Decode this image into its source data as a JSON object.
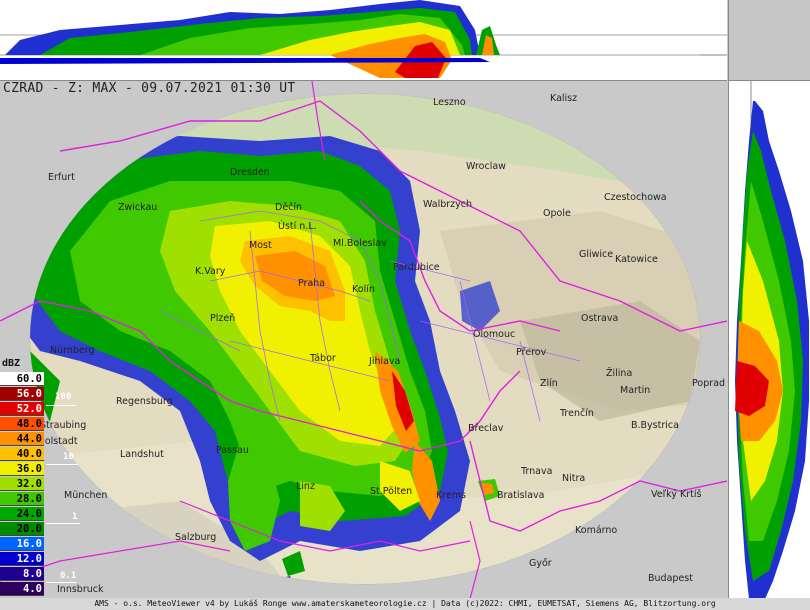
{
  "title": "CZRAD - Z: MAX - 09.07.2021 01:30 UT",
  "footer": "AMS - o.s. MeteoViewer v4 by Lukáš Ronge www.amaterskameteorologie.cz | Data (c)2022: CHMI, EUMETSAT, Siemens AG, Blitzortung.org",
  "legend": {
    "unit": "dBZ",
    "levels": [
      {
        "label": "60.0",
        "color": "#ffffff",
        "text": "#000000"
      },
      {
        "label": "56.0",
        "color": "#a00000",
        "text": "#ffffff"
      },
      {
        "label": "52.0",
        "color": "#e00000",
        "text": "#ffffff"
      },
      {
        "label": "48.0",
        "color": "#ff5000",
        "text": "#000000"
      },
      {
        "label": "44.0",
        "color": "#ff9000",
        "text": "#000000"
      },
      {
        "label": "40.0",
        "color": "#ffc000",
        "text": "#000000"
      },
      {
        "label": "36.0",
        "color": "#f0f000",
        "text": "#000000"
      },
      {
        "label": "32.0",
        "color": "#a0e000",
        "text": "#000000"
      },
      {
        "label": "28.0",
        "color": "#40c800",
        "text": "#000000"
      },
      {
        "label": "24.0",
        "color": "#00a800",
        "text": "#000000"
      },
      {
        "label": "20.0",
        "color": "#008c00",
        "text": "#000000"
      },
      {
        "label": "16.0",
        "color": "#0064ff",
        "text": "#ffffff"
      },
      {
        "label": "12.0",
        "color": "#0000d0",
        "text": "#ffffff"
      },
      {
        "label": "8.0",
        "color": "#200090",
        "text": "#ffffff"
      },
      {
        "label": "4.0",
        "color": "#300060",
        "text": "#ffffff"
      }
    ],
    "precip_marks": [
      "100",
      "10",
      "1",
      "0.1"
    ]
  },
  "cities": [
    {
      "name": "Leszno"
    },
    {
      "name": "Kalisz"
    },
    {
      "name": "Wroclaw"
    },
    {
      "name": "Dresden"
    },
    {
      "name": "Walbrzych"
    },
    {
      "name": "Czestochowa"
    },
    {
      "name": "Opole"
    },
    {
      "name": "Zwickau"
    },
    {
      "name": "Děčín"
    },
    {
      "name": "Ústí n.L."
    },
    {
      "name": "Most"
    },
    {
      "name": "Ml.Boleslav"
    },
    {
      "name": "Gliwice"
    },
    {
      "name": "Katowice"
    },
    {
      "name": "K.Vary"
    },
    {
      "name": "Praha"
    },
    {
      "name": "Kolín"
    },
    {
      "name": "Pardubice"
    },
    {
      "name": "Ostrava"
    },
    {
      "name": "Olomouc"
    },
    {
      "name": "Přerov"
    },
    {
      "name": "Žilina"
    },
    {
      "name": "Martin"
    },
    {
      "name": "Poprad"
    },
    {
      "name": "Tábor"
    },
    {
      "name": "Jihlava"
    },
    {
      "name": "Zlín"
    },
    {
      "name": "Regensburg"
    },
    {
      "name": "Trenčín"
    },
    {
      "name": "B.Bystrica"
    },
    {
      "name": "Straubing"
    },
    {
      "name": "Břeclav"
    },
    {
      "name": "Landshut"
    },
    {
      "name": "Trnava"
    },
    {
      "name": "Nitra"
    },
    {
      "name": "Passau"
    },
    {
      "name": "Bratislava"
    },
    {
      "name": "St.Pölten"
    },
    {
      "name": "Krems"
    },
    {
      "name": "Veľký Krtíš"
    },
    {
      "name": "München"
    },
    {
      "name": "Salzburg"
    },
    {
      "name": "Komárno"
    },
    {
      "name": "Győr"
    },
    {
      "name": "Budapest"
    },
    {
      "name": "Innsbruck"
    },
    {
      "name": "Erfurt"
    },
    {
      "name": "Nürnberg"
    },
    {
      "name": "Plzeň"
    },
    {
      "name": "Linz"
    },
    {
      "name": "Ingolstadt"
    }
  ]
}
